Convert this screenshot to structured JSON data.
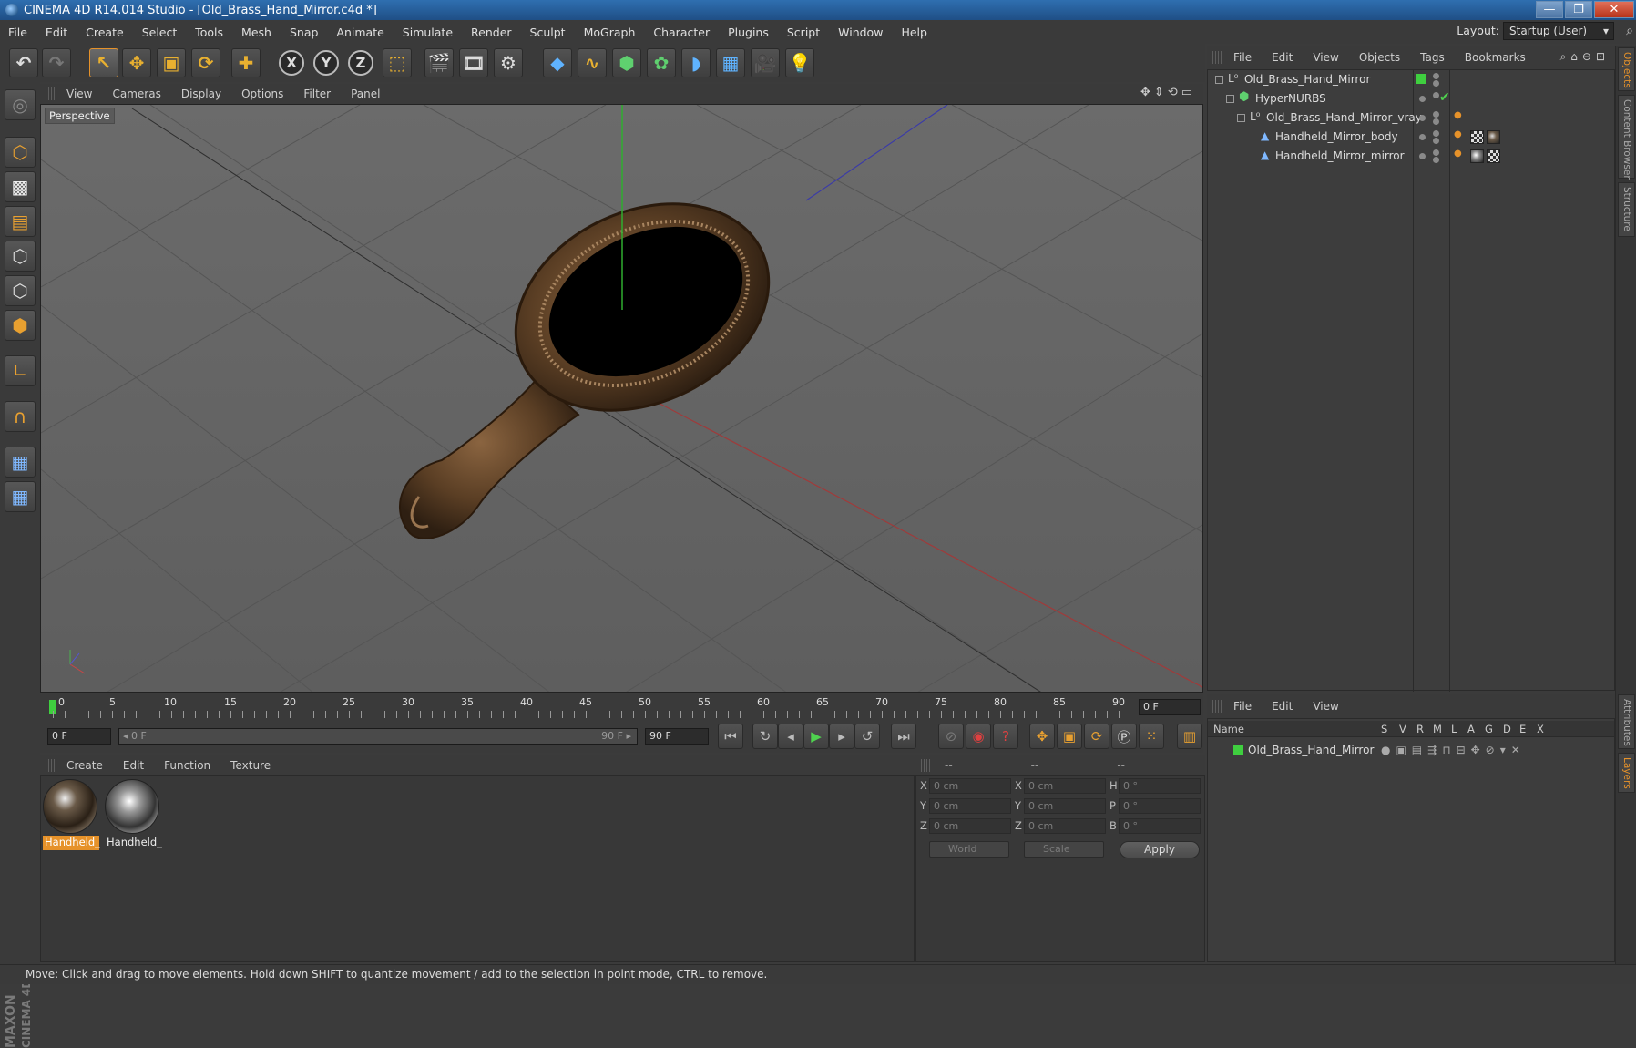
{
  "window": {
    "title": "CINEMA 4D R14.014 Studio - [Old_Brass_Hand_Mirror.c4d *]",
    "min": "—",
    "max": "❐",
    "close": "✕"
  },
  "menubar": {
    "items": [
      "File",
      "Edit",
      "Create",
      "Select",
      "Tools",
      "Mesh",
      "Snap",
      "Animate",
      "Simulate",
      "Render",
      "Sculpt",
      "MoGraph",
      "Character",
      "Plugins",
      "Script",
      "Window",
      "Help"
    ],
    "layout_label": "Layout:",
    "layout_value": "Startup (User)"
  },
  "viewport": {
    "menu": [
      "View",
      "Cameras",
      "Display",
      "Options",
      "Filter",
      "Panel"
    ],
    "camera_label": "Perspective"
  },
  "timeline": {
    "ticks": [
      "0",
      "5",
      "10",
      "15",
      "20",
      "25",
      "30",
      "35",
      "40",
      "45",
      "50",
      "55",
      "60",
      "65",
      "70",
      "75",
      "80",
      "85",
      "90"
    ],
    "current_frame": "0 F"
  },
  "transport": {
    "start": "0 F",
    "range_start": "◂ 0 F",
    "range_end": "90 F ▸",
    "end": "90 F"
  },
  "material_manager": {
    "menu": [
      "Create",
      "Edit",
      "Function",
      "Texture"
    ],
    "materials": [
      {
        "label": "Handheld_",
        "selected": true
      },
      {
        "label": "Handheld_",
        "selected": false
      }
    ]
  },
  "coordinates": {
    "header": [
      "--",
      "--",
      "--"
    ],
    "rows": [
      {
        "a": "X",
        "av": "0 cm",
        "b": "X",
        "bv": "0 cm",
        "c": "H",
        "cv": "0 °"
      },
      {
        "a": "Y",
        "av": "0 cm",
        "b": "Y",
        "bv": "0 cm",
        "c": "P",
        "cv": "0 °"
      },
      {
        "a": "Z",
        "av": "0 cm",
        "b": "Z",
        "bv": "0 cm",
        "c": "B",
        "cv": "0 °"
      }
    ],
    "mode": "World",
    "mode2": "Scale",
    "apply": "Apply"
  },
  "object_manager": {
    "menu": [
      "File",
      "Edit",
      "View",
      "Objects",
      "Tags",
      "Bookmarks"
    ],
    "objects": [
      {
        "name": "Old_Brass_Hand_Mirror",
        "indent": 0
      },
      {
        "name": "HyperNURBS",
        "indent": 1
      },
      {
        "name": "Old_Brass_Hand_Mirror_vray",
        "indent": 2
      },
      {
        "name": "Handheld_Mirror_body",
        "indent": 3
      },
      {
        "name": "Handheld_Mirror_mirror",
        "indent": 3
      }
    ]
  },
  "layers": {
    "menu": [
      "File",
      "Edit",
      "View"
    ],
    "columns": [
      "Name",
      "S",
      "V",
      "R",
      "M",
      "L",
      "A",
      "G",
      "D",
      "E",
      "X"
    ],
    "rows": [
      {
        "name": "Old_Brass_Hand_Mirror"
      }
    ]
  },
  "right_tabs": [
    "Objects",
    "Content Browser",
    "Structure",
    "Attributes",
    "Layers"
  ],
  "branding": {
    "maxon": "MAXON",
    "cinema": "CINEMA 4D"
  },
  "status": "Move: Click and drag to move elements. Hold down SHIFT to quantize movement / add to the selection in point mode, CTRL to remove.",
  "colors": {
    "accent": "#e6922a",
    "green_layer": "#3fcf3f"
  }
}
